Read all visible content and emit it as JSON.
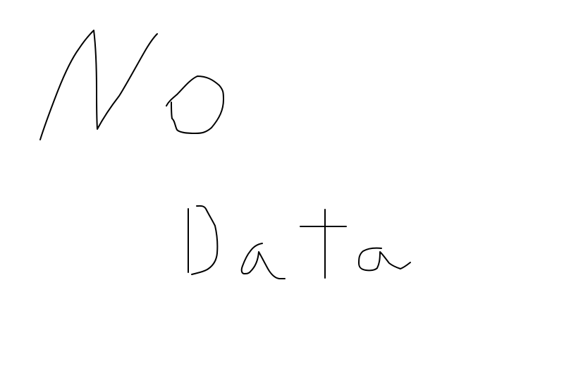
{
  "drawing": {
    "line1": "No",
    "line2": "Data",
    "ink_color": "#000000",
    "background": "#ffffff"
  }
}
